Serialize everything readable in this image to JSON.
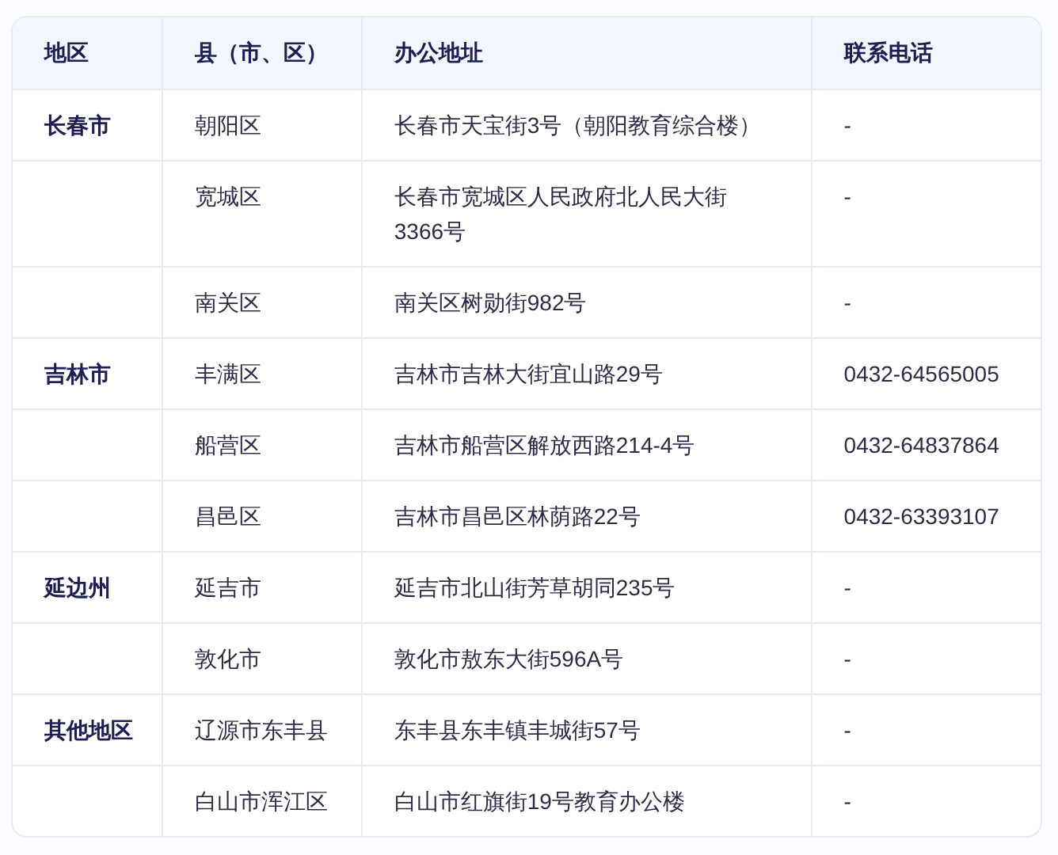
{
  "table": {
    "columns": [
      "地区",
      "县（市、区）",
      "办公地址",
      "联系电话"
    ],
    "rows": [
      {
        "region": "长春市",
        "county": "朝阳区",
        "address": "长春市天宝街3号（朝阳教育综合楼）",
        "phone": "-"
      },
      {
        "county": "宽城区",
        "address": "长春市宽城区人民政府北人民大街3366号",
        "phone": "-"
      },
      {
        "county": "南关区",
        "address": "南关区树勋街982号",
        "phone": "-"
      },
      {
        "region": "吉林市",
        "county": "丰满区",
        "address": "吉林市吉林大街宜山路29号",
        "phone": "0432-64565005"
      },
      {
        "county": "船营区",
        "address": "吉林市船营区解放西路214-4号",
        "phone": "0432-64837864"
      },
      {
        "county": "昌邑区",
        "address": "吉林市昌邑区林荫路22号",
        "phone": "0432-63393107"
      },
      {
        "region": "延边州",
        "county": "延吉市",
        "address": "延吉市北山街芳草胡同235号",
        "phone": "-"
      },
      {
        "county": "敦化市",
        "address": "敦化市敖东大街596A号",
        "phone": "-"
      },
      {
        "region": "其他地区",
        "county": "辽源市东丰县",
        "address": "东丰县东丰镇丰城街57号",
        "phone": "-"
      },
      {
        "county": "白山市浑江区",
        "address": "白山市红旗街19号教育办公楼",
        "phone": "-"
      }
    ]
  }
}
